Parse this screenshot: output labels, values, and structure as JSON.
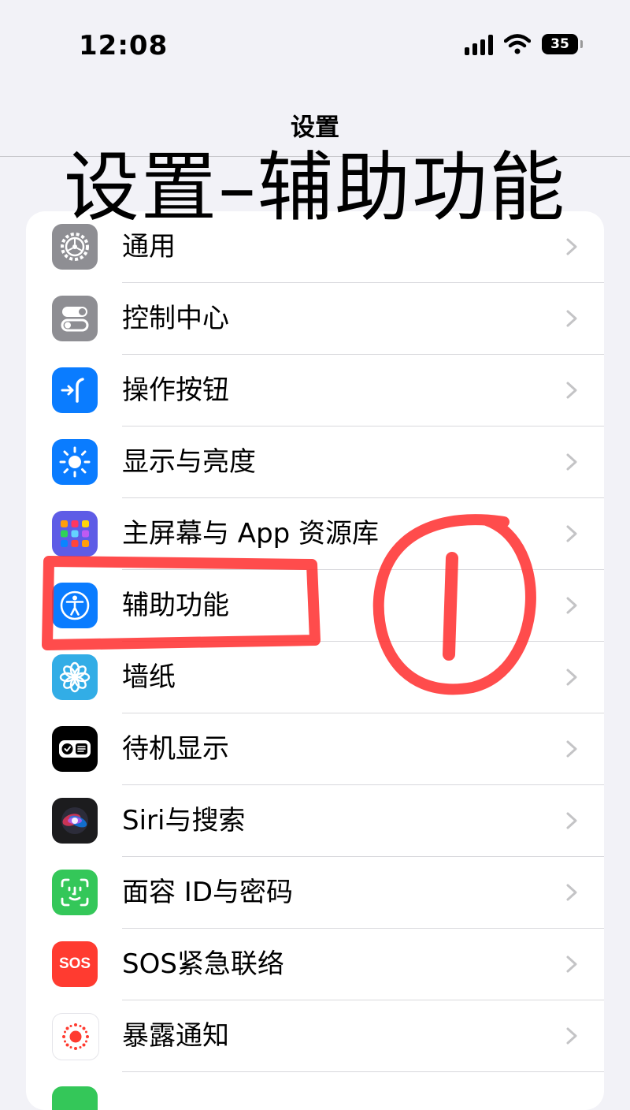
{
  "status_bar": {
    "time": "12:08",
    "battery": "35"
  },
  "nav": {
    "title": "设置"
  },
  "overlay_caption": "设置–辅助功能",
  "settings": {
    "general": {
      "label": "通用",
      "icon": "gear-icon",
      "color": "#8e8e93"
    },
    "control_center": {
      "label": "控制中心",
      "icon": "toggles-icon",
      "color": "#8e8e93"
    },
    "action_button": {
      "label": "操作按钮",
      "icon": "action-button-icon",
      "color": "#0a7cff"
    },
    "display": {
      "label": "显示与亮度",
      "icon": "sun-icon",
      "color": "#0a7cff"
    },
    "home_screen": {
      "label": "主屏幕与 App 资源库",
      "icon": "app-grid-icon",
      "color": "#5e5ce6"
    },
    "accessibility": {
      "label": "辅助功能",
      "icon": "accessibility-icon",
      "color": "#0a7cff"
    },
    "wallpaper": {
      "label": "墙纸",
      "icon": "flower-icon",
      "color": "#32ade6"
    },
    "standby": {
      "label": "待机显示",
      "icon": "standby-icon",
      "color": "#000000"
    },
    "siri": {
      "label": "Siri与搜索",
      "icon": "siri-icon",
      "color": "#1c1c1e"
    },
    "face_id": {
      "label": "面容 ID与密码",
      "icon": "face-id-icon",
      "color": "#34c759"
    },
    "sos": {
      "label": "SOS紧急联络",
      "icon": "sos-icon",
      "color": "#ff3b30",
      "icon_text": "SOS"
    },
    "exposure": {
      "label": "暴露通知",
      "icon": "exposure-icon",
      "color": "#ff3b30"
    }
  },
  "annotation": {
    "marker_color": "#ff2d2d"
  }
}
